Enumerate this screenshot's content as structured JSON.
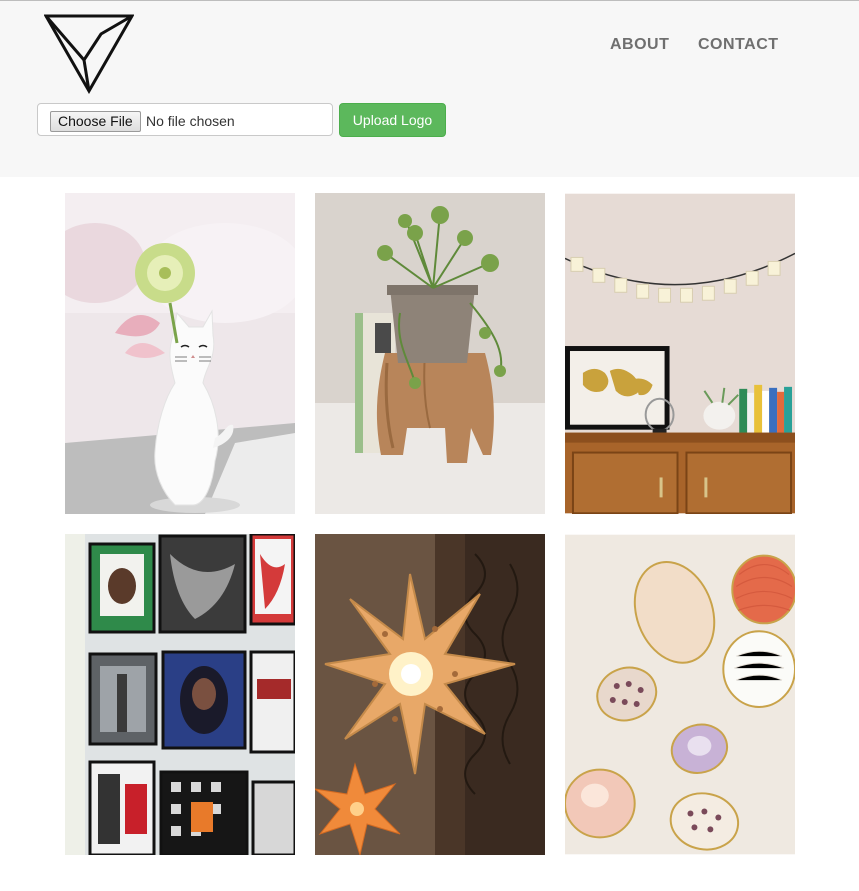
{
  "nav": {
    "about": "ABOUT",
    "contact": "CONTACT"
  },
  "upload": {
    "choose_label": "Choose File",
    "status": "No file chosen",
    "submit_label": "Upload Logo"
  },
  "colors": {
    "header_bg": "#f7f7f7",
    "nav_text": "#6f6f6f",
    "upload_button": "#5cb85c"
  },
  "gallery": {
    "items": [
      {
        "icon": "cat-vase-photo"
      },
      {
        "icon": "potted-plant-photo"
      },
      {
        "icon": "letter-lights-shelf-photo"
      },
      {
        "icon": "record-wall-photo"
      },
      {
        "icon": "star-lanterns-photo"
      },
      {
        "icon": "seashells-photo"
      }
    ]
  }
}
